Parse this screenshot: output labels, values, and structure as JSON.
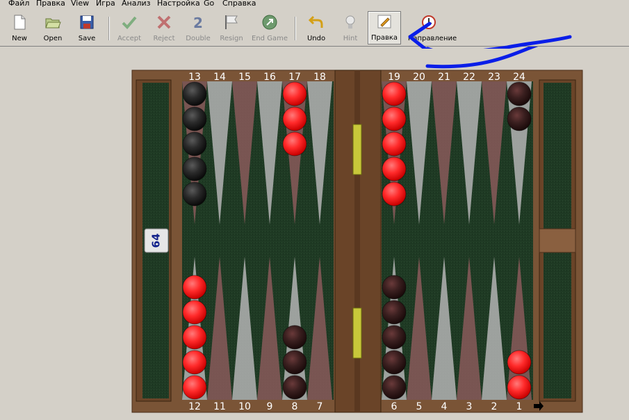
{
  "menu": [
    "Файл",
    "Правка",
    "View",
    "Игра",
    "Анализ",
    "Настройка",
    "Go",
    "Справка"
  ],
  "toolbar": {
    "new": "New",
    "open": "Open",
    "save": "Save",
    "accept": "Accept",
    "reject": "Reject",
    "double": "Double",
    "resign": "Resign",
    "end_game": "End Game",
    "undo": "Undo",
    "hint": "Hint",
    "edit": "Правка",
    "direction": "Направление"
  },
  "board": {
    "cube_value": "64",
    "top_labels": [
      "13",
      "14",
      "15",
      "16",
      "17",
      "18",
      "19",
      "20",
      "21",
      "22",
      "23",
      "24"
    ],
    "bottom_labels": [
      "12",
      "11",
      "10",
      "9",
      "8",
      "7",
      "6",
      "5",
      "4",
      "3",
      "2",
      "1"
    ],
    "checkers": {
      "13": {
        "color": "black",
        "count": 5
      },
      "17": {
        "color": "red",
        "count": 3
      },
      "19": {
        "color": "red",
        "count": 5
      },
      "24": {
        "color": "black",
        "count": 2
      },
      "12": {
        "color": "red",
        "count": 5
      },
      "8": {
        "color": "black",
        "count": 3
      },
      "6": {
        "color": "black",
        "count": 5
      },
      "1": {
        "color": "red",
        "count": 2
      }
    }
  },
  "colors": {
    "felt": "#1f3a24",
    "wood": "#7a5436",
    "red_checker": "#ff2a2a",
    "black_checker": "#2a2a2a",
    "light_point": "#b4b4b4",
    "dark_point": "#8a5a5a",
    "annotation_arrow": "#0a1ee8"
  }
}
